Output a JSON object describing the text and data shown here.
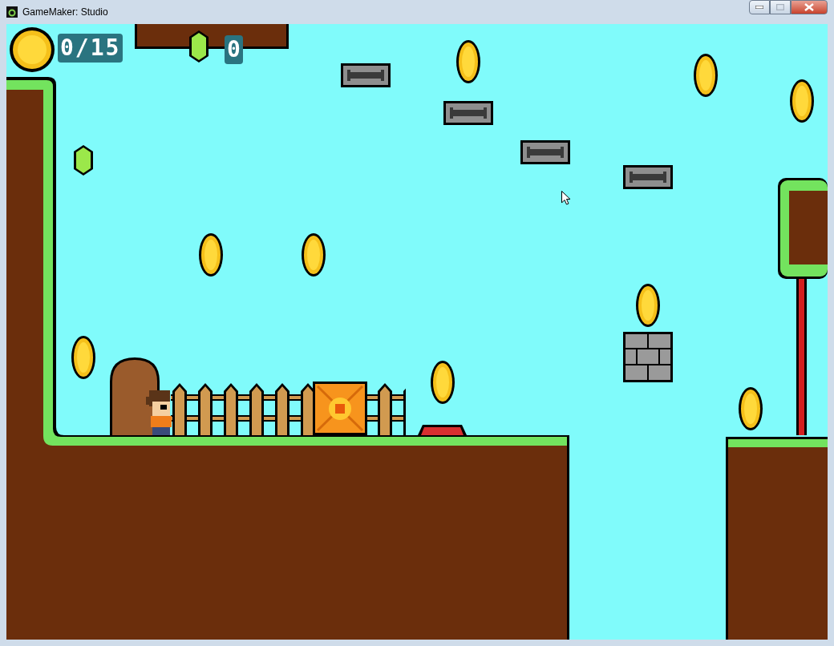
{
  "window": {
    "title": "GameMaker: Studio",
    "controls": [
      {
        "kind": "minimize",
        "disabled": false
      },
      {
        "kind": "maximize",
        "disabled": true
      },
      {
        "kind": "close",
        "disabled": false
      }
    ]
  },
  "hud": {
    "coins": "0/15",
    "gems": "0"
  }
}
